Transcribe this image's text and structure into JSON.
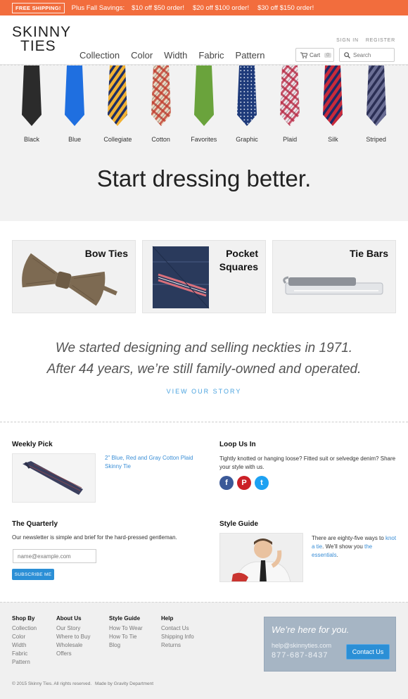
{
  "promo": {
    "badge": "FREE SHIPPING!",
    "lead": "Plus Fall Savings:",
    "offers": [
      "$10 off $50 order!",
      "$20 off $100 order!",
      "$30 off $150 order!"
    ]
  },
  "header": {
    "logo_line1": "SKINNY",
    "logo_line2": "TIES",
    "nav": [
      "Collection",
      "Color",
      "Width",
      "Fabric",
      "Pattern"
    ],
    "sign_in": "SIGN IN",
    "register": "REGISTER",
    "cart_label": "Cart",
    "cart_count": "0",
    "search_placeholder": "Search"
  },
  "ties": [
    {
      "name": "Black",
      "color": "#2b2b2b",
      "pattern": "solid"
    },
    {
      "name": "Blue",
      "color": "#1f6fe0",
      "pattern": "solid"
    },
    {
      "name": "Collegiate",
      "color": "#f2b233",
      "pattern": "stripe",
      "accent": "#1f2f66"
    },
    {
      "name": "Cotton",
      "color": "#e9d9c4",
      "pattern": "plaid",
      "accent": "#c0392b"
    },
    {
      "name": "Favorites",
      "color": "#6aa33c",
      "pattern": "solid"
    },
    {
      "name": "Graphic",
      "color": "#1e3a7a",
      "pattern": "dots",
      "accent": "#e8eef8"
    },
    {
      "name": "Plaid",
      "color": "#f1e3ea",
      "pattern": "plaid",
      "accent": "#b8243f"
    },
    {
      "name": "Silk",
      "color": "#c92a3a",
      "pattern": "stripe",
      "accent": "#1c2a66"
    },
    {
      "name": "Striped",
      "color": "#6b6f96",
      "pattern": "stripe",
      "accent": "#2b2f55"
    }
  ],
  "hero": {
    "title": "Start dressing better."
  },
  "categories": [
    {
      "label_line1": "Bow Ties",
      "label_line2": ""
    },
    {
      "label_line1": "Pocket",
      "label_line2": "Squares"
    },
    {
      "label_line1": "Tie Bars",
      "label_line2": ""
    }
  ],
  "story": {
    "line1": "We started designing and selling neckties in 1971.",
    "line2": "After 44 years, we’re still family-owned and operated.",
    "cta": "VIEW OUR STORY"
  },
  "weekly_pick": {
    "title": "Weekly Pick",
    "link": "2\" Blue, Red and Gray Cotton Plaid Skinny Tie"
  },
  "loop": {
    "title": "Loop Us In",
    "text": "Tightly knotted or hanging loose? Fitted suit or selvedge denim? Share your style with us.",
    "socials": [
      {
        "icon": "facebook-icon",
        "glyph": "f",
        "color": "#3b5998"
      },
      {
        "icon": "pinterest-icon",
        "glyph": "P",
        "color": "#cb2027"
      },
      {
        "icon": "twitter-icon",
        "glyph": "t",
        "color": "#1da1f2"
      }
    ]
  },
  "quarterly": {
    "title": "The Quarterly",
    "text": "Our newsletter is simple and brief for the hard-pressed gentleman.",
    "placeholder": "name@example.com",
    "button": "SUBSCRIBE ME"
  },
  "style_guide": {
    "title": "Style Guide",
    "text_before": "There are eighty-five ways to ",
    "link1": "knot a tie",
    "text_mid": ". We’ll show you ",
    "link2": "the essentials",
    "text_after": "."
  },
  "footer": {
    "columns": [
      {
        "heading": "Shop By",
        "items": [
          "Collection",
          "Color",
          "Width",
          "Fabric",
          "Pattern"
        ]
      },
      {
        "heading": "About Us",
        "items": [
          "Our Story",
          "Where to Buy",
          "Wholesale",
          "Offers"
        ]
      },
      {
        "heading": "Style Guide",
        "items": [
          "How To Wear",
          "How To Tie",
          "Blog"
        ]
      },
      {
        "heading": "Help",
        "items": [
          "Contact Us",
          "Shipping Info",
          "Returns"
        ]
      }
    ],
    "contact_heading": "We’re here for you.",
    "contact_email": "help@skinnyties.com",
    "contact_phone": "877-687-8437",
    "contact_button": "Contact Us",
    "copyright": "© 2015 Skinny Ties. All rights reserved.",
    "credit": "Made by Gravity Department"
  }
}
